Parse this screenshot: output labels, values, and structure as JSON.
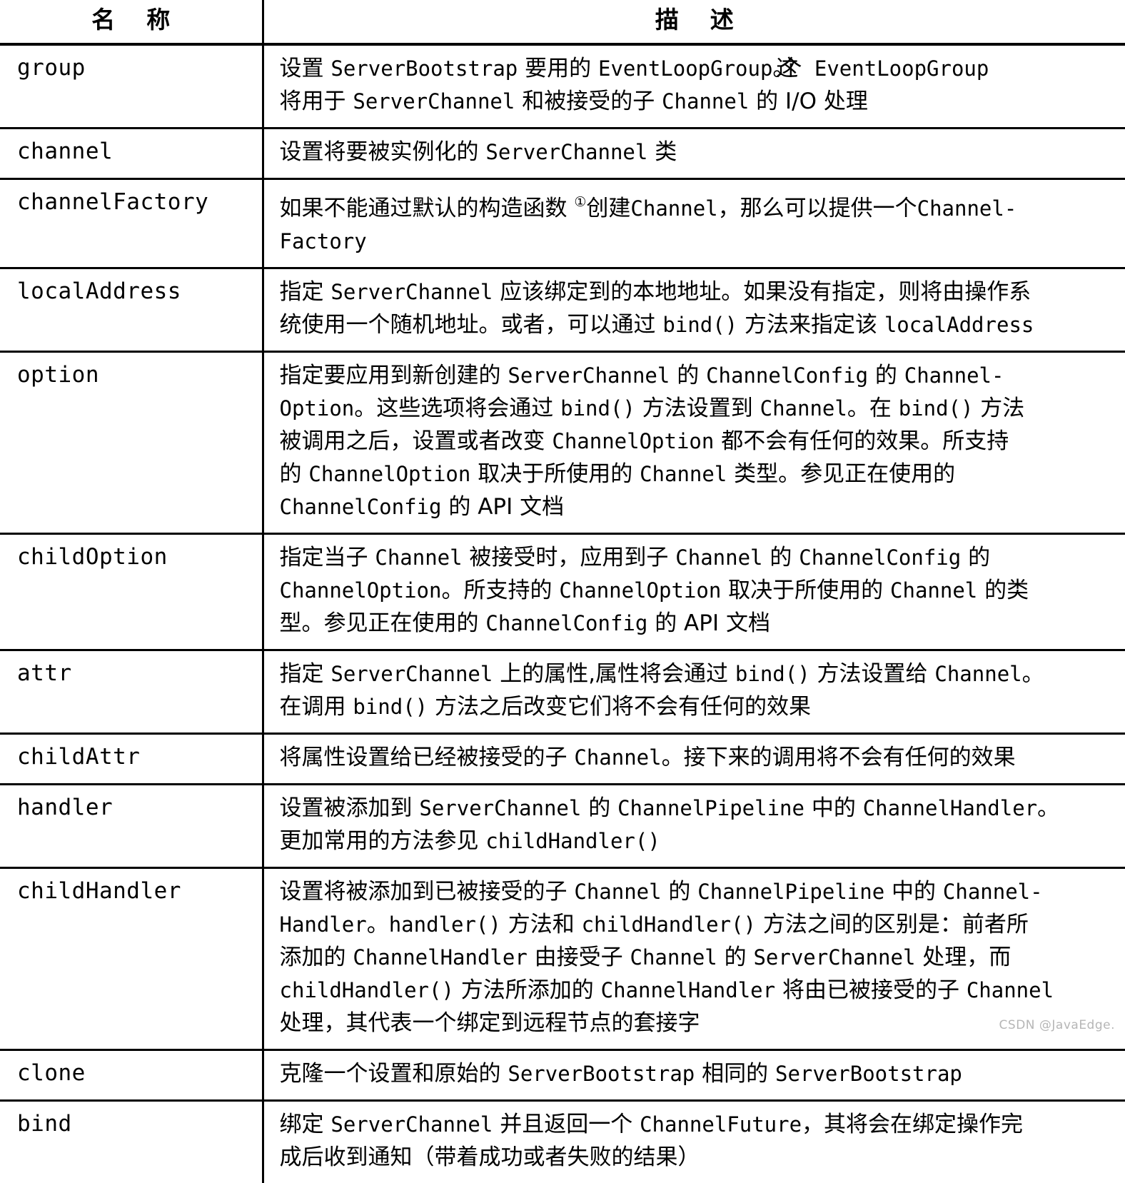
{
  "table": {
    "headers": {
      "name": "名　称",
      "name_parts": [
        "名",
        "称"
      ],
      "description": "描　述",
      "description_parts": [
        "描",
        "述"
      ]
    },
    "rows": [
      {
        "name": "group",
        "lines": [
          [
            {
              "t": "设置 ",
              "s": "han"
            },
            {
              "t": "ServerBootstrap",
              "s": "mono"
            },
            {
              "t": " 要用的 ",
              "s": "han"
            },
            {
              "t": "EventLoopGroup",
              "s": "mono"
            },
            {
              "t": "。这个",
              "s": "han-overlap"
            },
            {
              "t": "  ",
              "s": "mono"
            },
            {
              "t": "EventLoopGroup",
              "s": "mono"
            }
          ],
          [
            {
              "t": "将用于 ",
              "s": "han"
            },
            {
              "t": "ServerChannel",
              "s": "mono"
            },
            {
              "t": " 和被接受的子 ",
              "s": "han"
            },
            {
              "t": "Channel",
              "s": "mono"
            },
            {
              "t": " 的 I/O 处理",
              "s": "han"
            }
          ]
        ]
      },
      {
        "name": "channel",
        "lines": [
          [
            {
              "t": "设置将要被实例化的 ",
              "s": "han"
            },
            {
              "t": "ServerChannel",
              "s": "mono"
            },
            {
              "t": " 类",
              "s": "han"
            }
          ]
        ]
      },
      {
        "name": "channelFactory",
        "lines": [
          [
            {
              "t": "如果不能通过默认的构造函数 ",
              "s": "han"
            },
            {
              "t": "①",
              "s": "sup"
            },
            {
              "t": "创建",
              "s": "han"
            },
            {
              "t": "Channel",
              "s": "mono"
            },
            {
              "t": "，那么可以提供一个",
              "s": "han"
            },
            {
              "t": "Channel-",
              "s": "mono"
            }
          ],
          [
            {
              "t": "Factory",
              "s": "mono"
            }
          ]
        ]
      },
      {
        "name": "localAddress",
        "lines": [
          [
            {
              "t": "指定 ",
              "s": "han"
            },
            {
              "t": "ServerChannel",
              "s": "mono"
            },
            {
              "t": " 应该绑定到的本地地址。如果没有指定，则将由操作系",
              "s": "han"
            }
          ],
          [
            {
              "t": "统使用一个随机地址。或者，可以通过 ",
              "s": "han"
            },
            {
              "t": "bind()",
              "s": "mono"
            },
            {
              "t": " 方法来指定该 ",
              "s": "han"
            },
            {
              "t": "localAddress",
              "s": "mono"
            }
          ]
        ]
      },
      {
        "name": "option",
        "lines": [
          [
            {
              "t": "指定要应用到新创建的 ",
              "s": "han"
            },
            {
              "t": "ServerChannel",
              "s": "mono"
            },
            {
              "t": " 的 ",
              "s": "han"
            },
            {
              "t": "ChannelConfig",
              "s": "mono"
            },
            {
              "t": " 的 ",
              "s": "han"
            },
            {
              "t": "Channel-",
              "s": "mono"
            }
          ],
          [
            {
              "t": "Option",
              "s": "mono"
            },
            {
              "t": "。这些选项将会通过 ",
              "s": "han"
            },
            {
              "t": "bind()",
              "s": "mono"
            },
            {
              "t": " 方法设置到 ",
              "s": "han"
            },
            {
              "t": "Channel",
              "s": "mono"
            },
            {
              "t": "。在 ",
              "s": "han"
            },
            {
              "t": "bind()",
              "s": "mono"
            },
            {
              "t": " 方法",
              "s": "han"
            }
          ],
          [
            {
              "t": "被调用之后，设置或者改变 ",
              "s": "han"
            },
            {
              "t": "ChannelOption",
              "s": "mono"
            },
            {
              "t": " 都不会有任何的效果。所支持",
              "s": "han"
            }
          ],
          [
            {
              "t": "的 ",
              "s": "han"
            },
            {
              "t": "ChannelOption",
              "s": "mono"
            },
            {
              "t": " 取决于所使用的 ",
              "s": "han"
            },
            {
              "t": "Channel",
              "s": "mono"
            },
            {
              "t": " 类型。参见正在使用的",
              "s": "han"
            }
          ],
          [
            {
              "t": "ChannelConfig",
              "s": "mono"
            },
            {
              "t": " 的 API 文档",
              "s": "han"
            }
          ]
        ]
      },
      {
        "name": "childOption",
        "lines": [
          [
            {
              "t": "指定当子 ",
              "s": "han"
            },
            {
              "t": "Channel",
              "s": "mono"
            },
            {
              "t": " 被接受时，应用到子 ",
              "s": "han"
            },
            {
              "t": "Channel",
              "s": "mono"
            },
            {
              "t": " 的 ",
              "s": "han"
            },
            {
              "t": "ChannelConfig",
              "s": "mono"
            },
            {
              "t": " 的",
              "s": "han"
            }
          ],
          [
            {
              "t": "ChannelOption",
              "s": "mono"
            },
            {
              "t": "。所支持的 ",
              "s": "han"
            },
            {
              "t": "ChannelOption",
              "s": "mono"
            },
            {
              "t": " 取决于所使用的 ",
              "s": "han"
            },
            {
              "t": "Channel",
              "s": "mono"
            },
            {
              "t": " 的类",
              "s": "han"
            }
          ],
          [
            {
              "t": "型。参见正在使用的 ",
              "s": "han"
            },
            {
              "t": "ChannelConfig",
              "s": "mono"
            },
            {
              "t": " 的 API 文档",
              "s": "han"
            }
          ]
        ]
      },
      {
        "name": "attr",
        "lines": [
          [
            {
              "t": "指定 ",
              "s": "han"
            },
            {
              "t": "ServerChannel",
              "s": "mono"
            },
            {
              "t": " 上的属性,属性将会通过 ",
              "s": "han"
            },
            {
              "t": "bind()",
              "s": "mono"
            },
            {
              "t": " 方法设置给 ",
              "s": "han"
            },
            {
              "t": "Channel",
              "s": "mono"
            },
            {
              "t": "。",
              "s": "han"
            }
          ],
          [
            {
              "t": "在调用 ",
              "s": "han"
            },
            {
              "t": "bind()",
              "s": "mono"
            },
            {
              "t": " 方法之后改变它们将不会有任何的效果",
              "s": "han"
            }
          ]
        ]
      },
      {
        "name": "childAttr",
        "lines": [
          [
            {
              "t": "将属性设置给已经被接受的子 ",
              "s": "han"
            },
            {
              "t": "Channel",
              "s": "mono"
            },
            {
              "t": "。接下来的调用将不会有任何的效果",
              "s": "han"
            }
          ]
        ]
      },
      {
        "name": "handler",
        "lines": [
          [
            {
              "t": "设置被添加到 ",
              "s": "han"
            },
            {
              "t": "ServerChannel",
              "s": "mono"
            },
            {
              "t": " 的 ",
              "s": "han"
            },
            {
              "t": "ChannelPipeline",
              "s": "mono"
            },
            {
              "t": " 中的 ",
              "s": "han"
            },
            {
              "t": "ChannelHandler",
              "s": "mono"
            },
            {
              "t": "。",
              "s": "han"
            }
          ],
          [
            {
              "t": "更加常用的方法参见 ",
              "s": "han"
            },
            {
              "t": "childHandler()",
              "s": "mono"
            }
          ]
        ]
      },
      {
        "name": "childHandler",
        "lines": [
          [
            {
              "t": "设置将被添加到已被接受的子 ",
              "s": "han"
            },
            {
              "t": "Channel",
              "s": "mono"
            },
            {
              "t": " 的 ",
              "s": "han"
            },
            {
              "t": "ChannelPipeline",
              "s": "mono"
            },
            {
              "t": " 中的 ",
              "s": "han"
            },
            {
              "t": "Channel-",
              "s": "mono"
            }
          ],
          [
            {
              "t": "Handler",
              "s": "mono"
            },
            {
              "t": "。",
              "s": "han"
            },
            {
              "t": "handler()",
              "s": "mono"
            },
            {
              "t": " 方法和 ",
              "s": "han"
            },
            {
              "t": "childHandler()",
              "s": "mono"
            },
            {
              "t": " 方法之间的区别是：前者所",
              "s": "han"
            }
          ],
          [
            {
              "t": "添加的 ",
              "s": "han"
            },
            {
              "t": "ChannelHandler",
              "s": "mono"
            },
            {
              "t": " 由接受子 ",
              "s": "han"
            },
            {
              "t": "Channel",
              "s": "mono"
            },
            {
              "t": " 的 ",
              "s": "han"
            },
            {
              "t": "ServerChannel",
              "s": "mono"
            },
            {
              "t": " 处理，而",
              "s": "han"
            }
          ],
          [
            {
              "t": "childHandler()",
              "s": "mono"
            },
            {
              "t": " 方法所添加的 ",
              "s": "han"
            },
            {
              "t": "ChannelHandler",
              "s": "mono"
            },
            {
              "t": " 将由已被接受的子 ",
              "s": "han"
            },
            {
              "t": "Channel",
              "s": "mono"
            }
          ],
          [
            {
              "t": "处理，其代表一个绑定到远程节点的套接字",
              "s": "han"
            }
          ]
        ]
      },
      {
        "name": "clone",
        "lines": [
          [
            {
              "t": "克隆一个设置和原始的 ",
              "s": "han"
            },
            {
              "t": "ServerBootstrap",
              "s": "mono"
            },
            {
              "t": " 相同的 ",
              "s": "han"
            },
            {
              "t": "ServerBootstrap",
              "s": "mono"
            }
          ]
        ]
      },
      {
        "name": "bind",
        "lines": [
          [
            {
              "t": "绑定 ",
              "s": "han"
            },
            {
              "t": "ServerChannel",
              "s": "mono"
            },
            {
              "t": " 并且返回一个 ",
              "s": "han"
            },
            {
              "t": "ChannelFuture",
              "s": "mono"
            },
            {
              "t": "，其将会在绑定操作完",
              "s": "han"
            }
          ],
          [
            {
              "t": "成后收到通知（带着成功或者失败的结果）",
              "s": "han"
            }
          ]
        ]
      }
    ]
  },
  "watermark": "CSDN @JavaEdge."
}
